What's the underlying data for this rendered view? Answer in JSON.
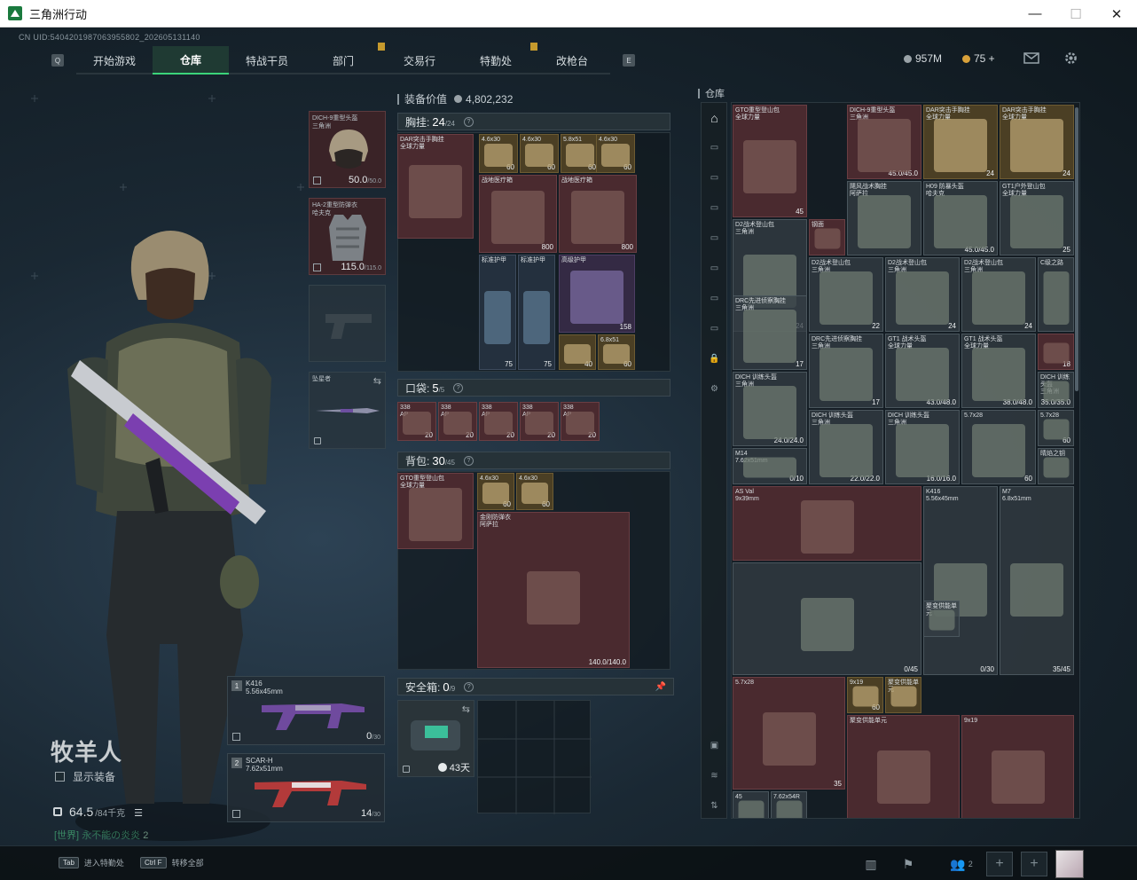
{
  "window": {
    "title": "三角洲行动",
    "minimize": "—",
    "maximize": "☐",
    "close": "✕"
  },
  "uid": "CN UID:5404201987063955802_202605131140",
  "nav": {
    "left_key": "Q",
    "right_key": "E",
    "tabs": [
      "开始游戏",
      "仓库",
      "特战干员",
      "部门",
      "交易行",
      "特勤处",
      "改枪台"
    ],
    "active_index": 1
  },
  "currency": {
    "haf_coin": "957M",
    "tickets": "75 +"
  },
  "character": {
    "name": "牧羊人",
    "show_equipment": "显示装备",
    "weight": "64.5",
    "weight_max": "/84千克",
    "world_prefix": "[世界]",
    "world_msg": "永不能の炎炎",
    "world_count": "2"
  },
  "equipment": {
    "helmet": {
      "name": "DICH-9重型头盔",
      "brand": "三角洲",
      "dur": "50.0",
      "max": "/50.0"
    },
    "armor": {
      "name": "HA-2重型防弹衣",
      "brand": "哈夫克",
      "dur": "115.0",
      "max": "/115.0"
    },
    "melee": {
      "name": "坠星者"
    },
    "primary": {
      "slot": "1",
      "name": "K416",
      "caliber": "5.56x45mm",
      "ammo": "0",
      "ammo_max": "/30"
    },
    "secondary": {
      "slot": "2",
      "name": "SCAR-H",
      "caliber": "7.62x51mm",
      "ammo": "14",
      "ammo_max": "/30"
    }
  },
  "inventory": {
    "value_label": "装备价值",
    "value": "4,802,232",
    "chest": {
      "label": "胸挂:",
      "count": "24",
      "max": "/24"
    },
    "pocket": {
      "label": "口袋:",
      "count": "5",
      "max": "/5"
    },
    "backpack": {
      "label": "背包:",
      "count": "30",
      "max": "/45"
    },
    "safe": {
      "label": "安全箱:",
      "count": "0",
      "max": "/9",
      "days": "43天"
    },
    "chest_items": [
      {
        "label": "DAR突击手胸挂\n全球力量",
        "count": ""
      },
      {
        "label": "4.6x30",
        "count": "60"
      },
      {
        "label": "4.6x30",
        "count": "60"
      },
      {
        "label": "5.8x51",
        "count": "60"
      },
      {
        "label": "4.6x30",
        "count": "60"
      },
      {
        "label": "战地医疗箱",
        "count": "800"
      },
      {
        "label": "战地医疗箱",
        "count": "800"
      },
      {
        "label": "标准护甲",
        "count": "75"
      },
      {
        "label": "标准护甲",
        "count": "75"
      },
      {
        "label": "高级护甲",
        "count": "158"
      },
      {
        "label": "",
        "count": "40"
      },
      {
        "label": "6.8x51",
        "count": "60"
      }
    ],
    "pocket_items": [
      {
        "label": "338\nAP",
        "count": "20"
      },
      {
        "label": "338\nAP",
        "count": "20"
      },
      {
        "label": "338\nAP",
        "count": "20"
      },
      {
        "label": "338\nAP",
        "count": "20"
      },
      {
        "label": "338\nAP",
        "count": "20"
      }
    ],
    "backpack_items": [
      {
        "label": "GTO重型登山包\n全球力量",
        "count": ""
      },
      {
        "label": "4.6x30",
        "count": "60"
      },
      {
        "label": "4.6x30",
        "count": "60"
      },
      {
        "label": "金刚防弹衣\n阿萨拉",
        "count": "140.0/140.0"
      }
    ]
  },
  "warehouse": {
    "label": "仓库",
    "items": [
      {
        "label": "GTO重型登山包\n全球力量",
        "count": "45"
      },
      {
        "label": "DICH-9重型头盔\n三角洲",
        "count": "45.0/45.0"
      },
      {
        "label": "DAR突击手胸挂\n全球力量",
        "count": "24"
      },
      {
        "label": "DAR突击手胸挂\n全球力量",
        "count": "24"
      },
      {
        "label": "飓风战术胸挂\n阿萨拉",
        "count": ""
      },
      {
        "label": "H09 防暴头盔\n哈夫克",
        "count": "45.0/45.0"
      },
      {
        "label": "GT1户外登山包\n全球力量",
        "count": "25"
      },
      {
        "label": "D2战术登山包\n三角洲",
        "count": "24"
      },
      {
        "label": "钢面",
        "count": ""
      },
      {
        "label": "D2战术登山包\n三角洲",
        "count": "22"
      },
      {
        "label": "D2战术登山包\n三角洲",
        "count": "24"
      },
      {
        "label": "D2战术登山包\n三角洲",
        "count": "24"
      },
      {
        "label": "C级之路",
        "count": ""
      },
      {
        "label": "DRC先进侦察胸挂\n三角洲",
        "count": "17"
      },
      {
        "label": "DRC先进侦察胸挂\n三角洲",
        "count": "17"
      },
      {
        "label": "GT1 战术头盔\n全球力量",
        "count": "43.0/48.0"
      },
      {
        "label": "GT1 战术头盔\n全球力量",
        "count": "38.0/48.0"
      },
      {
        "label": "",
        "count": "18"
      },
      {
        "label": "DICH 训练头盔\n三角洲",
        "count": "35.0/35.0"
      },
      {
        "label": "DICH 训练头盔\n三角洲",
        "count": "24.0/24.0"
      },
      {
        "label": "DICH 训练头盔\n三角洲",
        "count": "22.0/22.0"
      },
      {
        "label": "DICH 训练头盔\n三角洲",
        "count": "16.0/16.0"
      },
      {
        "label": "5.7x28",
        "count": "60"
      },
      {
        "label": "5.7x28",
        "count": "60"
      },
      {
        "label": "晴焰之钥",
        "count": ""
      },
      {
        "label": "M14\n7.62x51mm",
        "count": "0/10"
      },
      {
        "label": "AS Val\n9x39mm",
        "count": ""
      },
      {
        "label": "K416\n5.56x45mm",
        "count": "0/30"
      },
      {
        "label": "M7\n6.8x51mm",
        "count": "35/45"
      },
      {
        "label": "",
        "count": "0/45"
      },
      {
        "label": "聚变供能单元",
        "count": ""
      },
      {
        "label": "5.7x28",
        "count": "35"
      },
      {
        "label": "9x19",
        "count": "60"
      },
      {
        "label": "聚变供能单元",
        "count": ""
      },
      {
        "label": "聚变供能单元",
        "count": ""
      },
      {
        "label": "9x19",
        "count": "34"
      },
      {
        "label": "45",
        "count": "51"
      },
      {
        "label": "7.62x54R",
        "count": "60"
      }
    ]
  },
  "bottom": {
    "hint1_key": "Tab",
    "hint1": "进入特勤处",
    "hint2_key": "Ctrl F",
    "hint2": "转移全部",
    "squad_count": "2"
  }
}
